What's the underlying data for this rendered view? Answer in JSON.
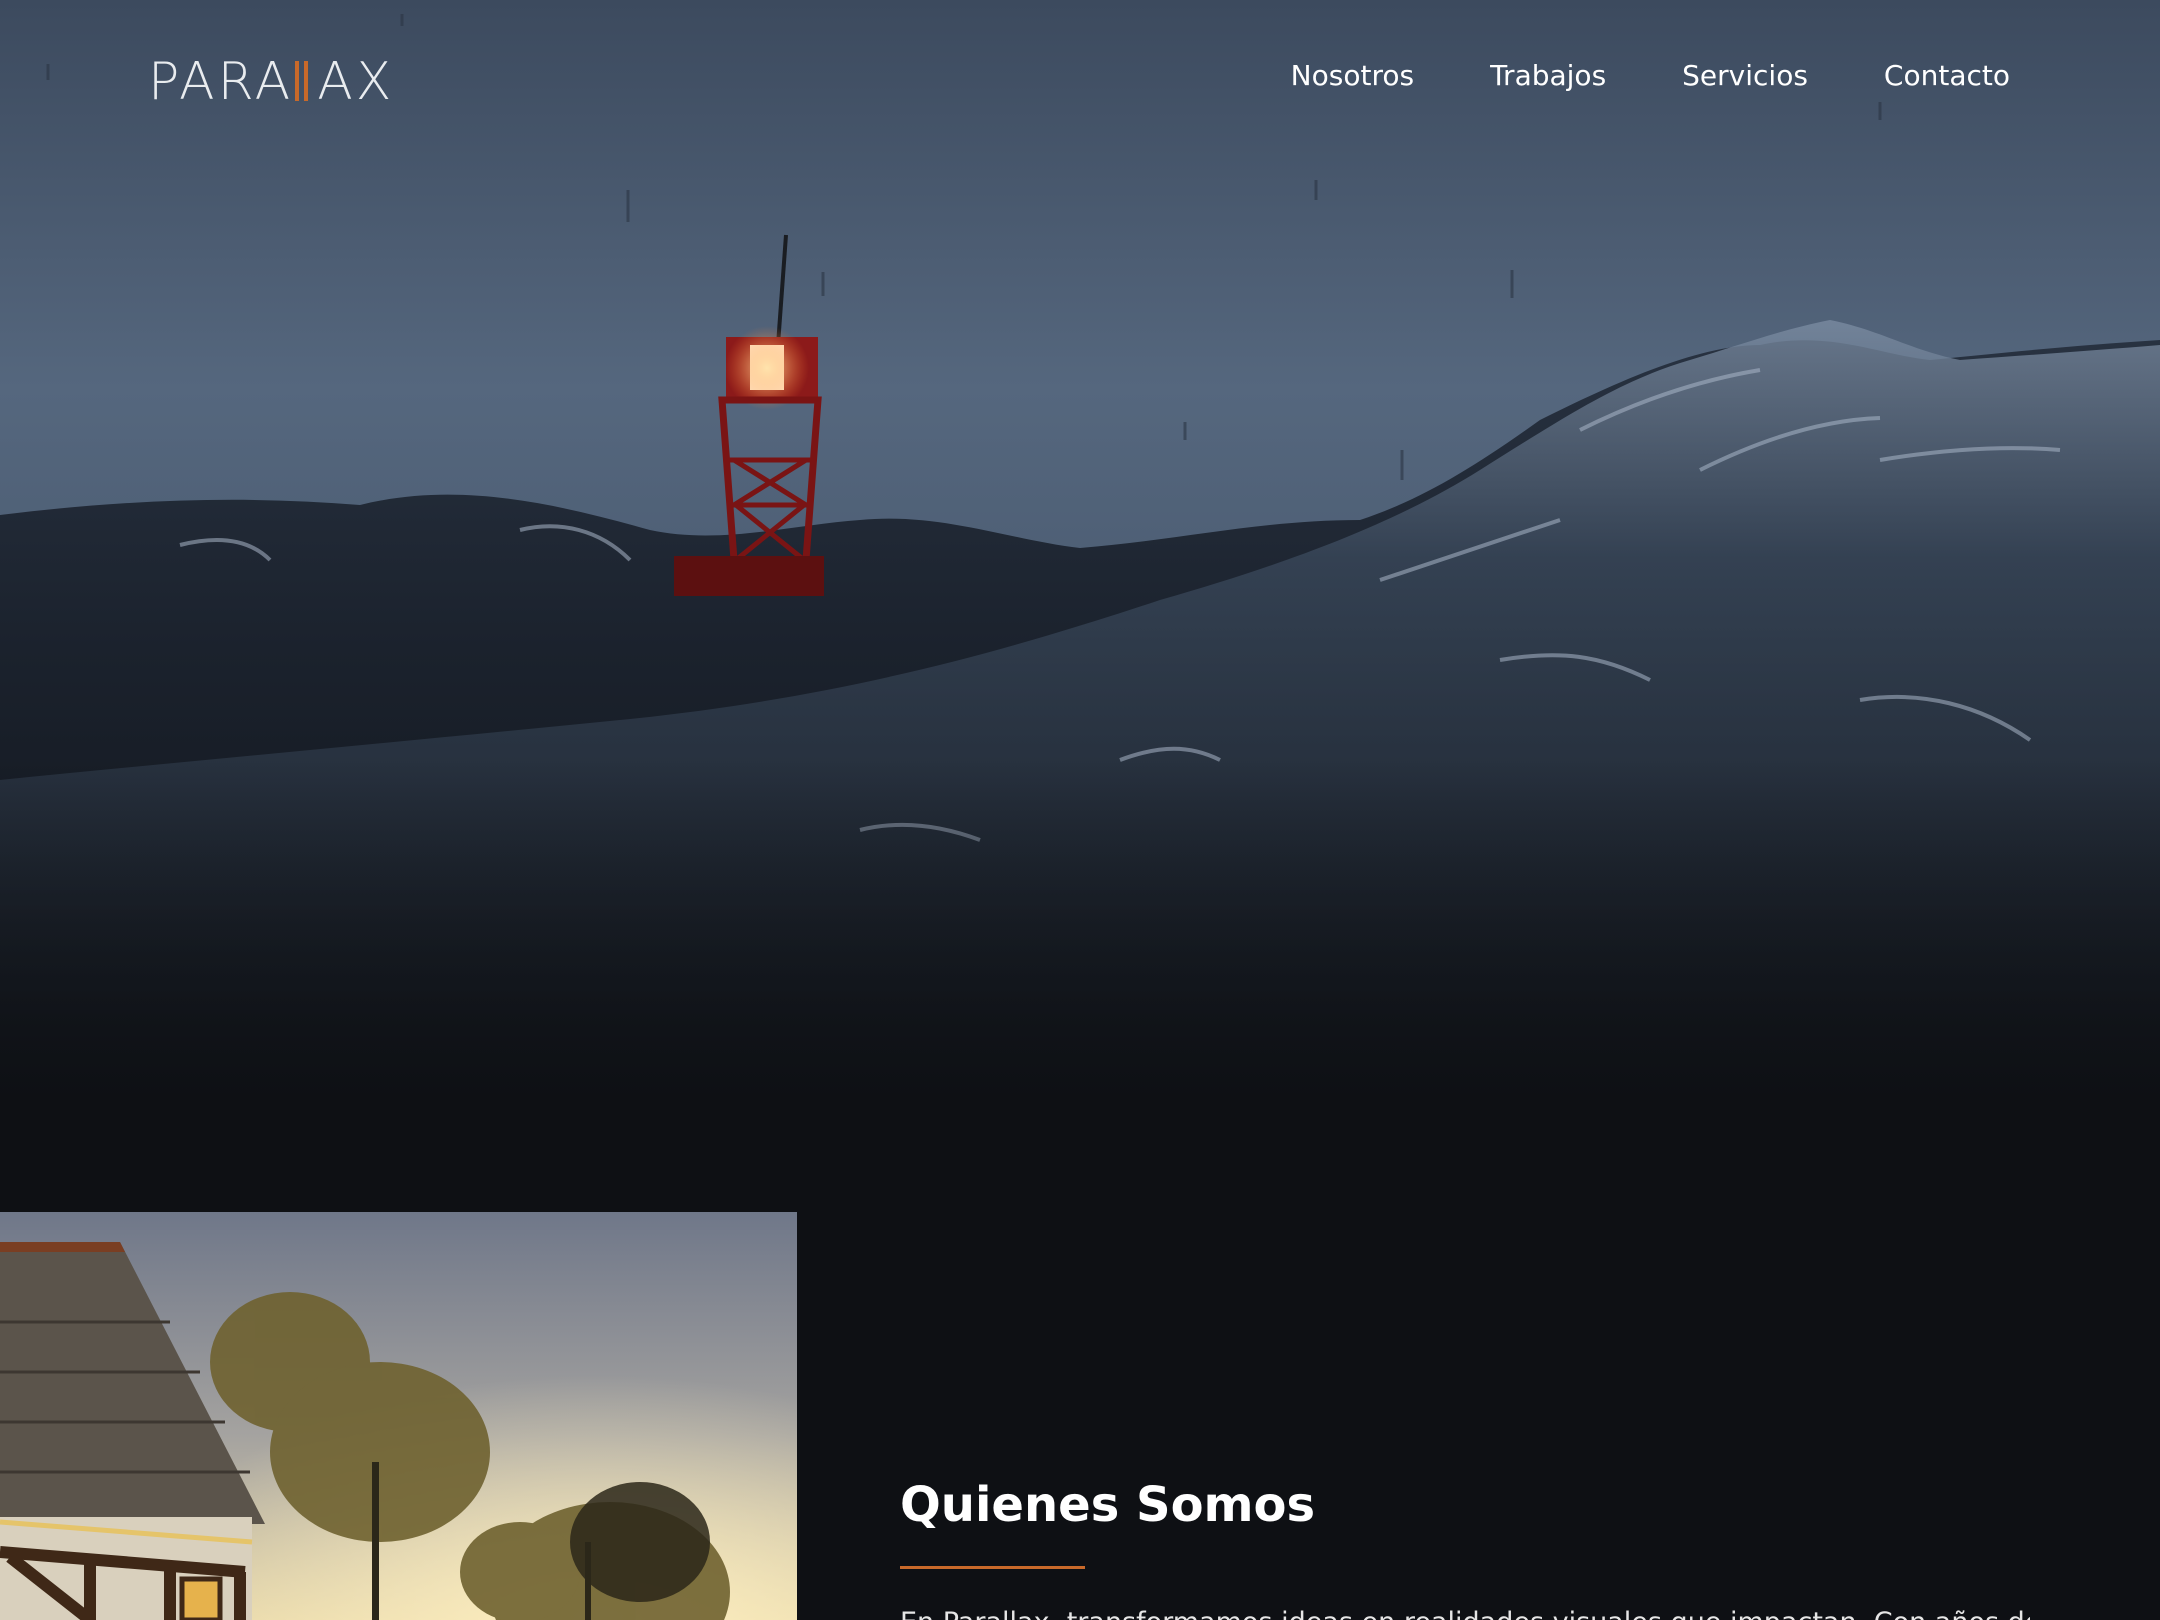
{
  "header": {
    "logo": {
      "before": "PARA",
      "after": "AX",
      "accent_color": "#c8692a"
    },
    "nav": [
      {
        "label": "Nosotros"
      },
      {
        "label": "Trabajos"
      },
      {
        "label": "Servicios"
      },
      {
        "label": "Contacto"
      }
    ]
  },
  "about": {
    "title": "Quienes Somos",
    "accent_color": "#c8692a",
    "body": "En Parallax, transformamos ideas en realidades visuales que impactan. Con años de experiencia en el"
  }
}
